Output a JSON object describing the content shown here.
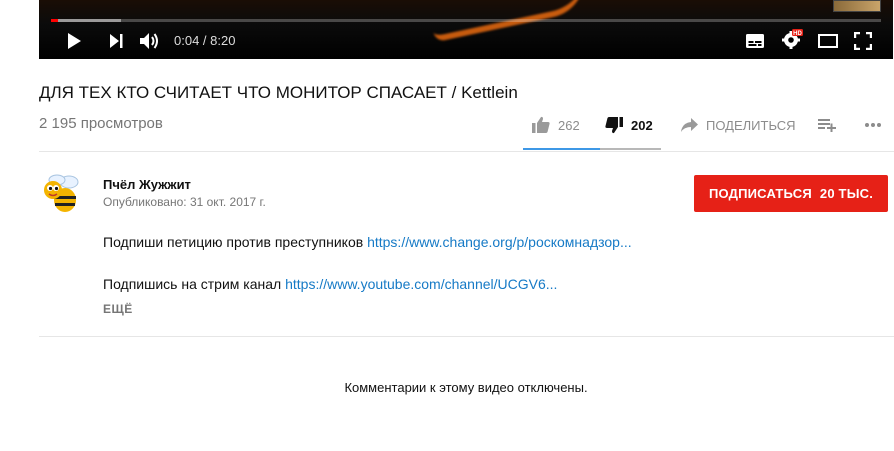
{
  "player": {
    "time": "0:04 / 8:20",
    "hd_badge": "HD",
    "progress_played_fraction": 0.008
  },
  "video": {
    "title": "ДЛЯ ТЕХ КТО СЧИТАЕТ ЧТО МОНИТОР СПАСАЕТ / Kettlein",
    "views": "2 195 просмотров",
    "likes": "262",
    "dislikes": "202",
    "share_label": "ПОДЕЛИТЬСЯ"
  },
  "channel": {
    "name": "Пчёл Жужжит",
    "published": "Опубликовано: 31 окт. 2017 г.",
    "subscribe_label": "ПОДПИСАТЬСЯ",
    "subscriber_count": "20 ТЫС."
  },
  "description": {
    "line1_text": "Подпиши петицию против преступников ",
    "line1_link": "https://www.change.org/p/роскомнадзор...",
    "line2_text": "Подпишись на стрим канал ",
    "line2_link": "https://www.youtube.com/channel/UCGV6...",
    "more_label": "ЕЩЁ"
  },
  "comments": {
    "disabled_message": "Комментарии к этому видео отключены."
  },
  "colors": {
    "subscribe_bg": "#e62117",
    "link": "#167ac6",
    "progress_red": "#ff0000",
    "like_underline": "#3e98e6"
  }
}
